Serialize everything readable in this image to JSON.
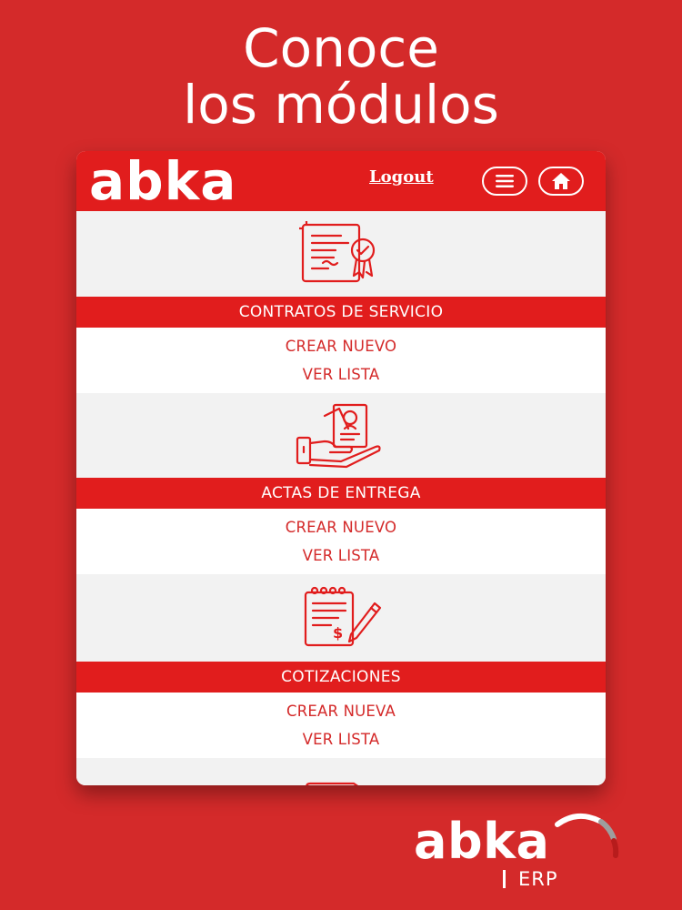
{
  "headline": {
    "line1": "Conoce",
    "line2": "los módulos"
  },
  "app": {
    "logo": "abka",
    "logout_label": "Logout",
    "menu_icon": "hamburger-menu-icon",
    "home_icon": "home-icon"
  },
  "modules": [
    {
      "title": "CONTRATOS DE SERVICIO",
      "icon": "contract-certificate-icon",
      "create_label": "CREAR NUEVO",
      "list_label": "VER LISTA"
    },
    {
      "title": "ACTAS DE ENTREGA",
      "icon": "delivery-handover-icon",
      "create_label": "CREAR NUEVO",
      "list_label": "VER LISTA"
    },
    {
      "title": "COTIZACIONES",
      "icon": "quotation-notepad-icon",
      "create_label": "CREAR NUEVA",
      "list_label": "VER LISTA"
    }
  ],
  "brand": {
    "logo": "abka",
    "sub": "ERP"
  },
  "colors": {
    "background": "#d42a2a",
    "accent": "#e11d1d",
    "white": "#ffffff"
  }
}
